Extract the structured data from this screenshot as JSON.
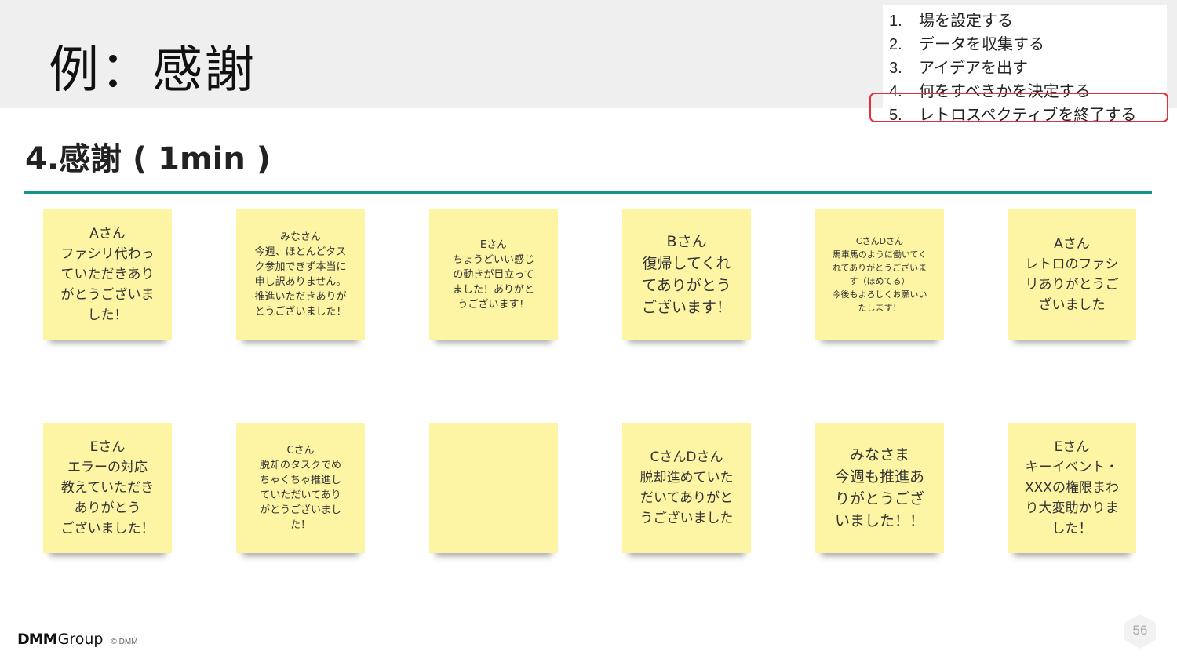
{
  "slide": {
    "title": "例：感謝",
    "board_title": "4.感謝 ( 1min )",
    "page_number": "56"
  },
  "steps": [
    {
      "num": "1.",
      "label": "場を設定する"
    },
    {
      "num": "2.",
      "label": "データを収集する"
    },
    {
      "num": "3.",
      "label": "アイデアを出す"
    },
    {
      "num": "4.",
      "label": "何をすべきかを決定する"
    },
    {
      "num": "5.",
      "label": "レトロスペクティブを終了する"
    }
  ],
  "highlighted_step": "5.",
  "notes": [
    {
      "text": "Aさん\nファシリ代わっ\nていただきあり\nがとうございま\nした！"
    },
    {
      "text": "みなさん\n今週、ほとんどタス\nク参加できず本当に\n申し訳ありません。\n推進いただきありが\nとうございました！"
    },
    {
      "text": "Eさん\nちょうどいい感じ\nの動きが目立って\nました！ありがと\nうございます！"
    },
    {
      "text": "Bさん\n復帰してくれ\nてありがとう\nございます！"
    },
    {
      "text": "CさんDさん\n馬車馬のように働いてく\nれてありがとうございま\nす（ほめてる）\n今後もよろしくお願いい\nたします！"
    },
    {
      "text": "Aさん\nレトロのファシ\nリありがとうご\nざいました"
    },
    {
      "text": "Eさん\nエラーの対応\n教えていただき\nありがとう\nございました！"
    },
    {
      "text": "Cさん\n脱却のタスクでめ\nちゃくちゃ推進し\nていただいてあり\nがとうございまし\nた！"
    },
    {
      "text": ""
    },
    {
      "text": "CさんDさん\n脱却進めていた\nだいてありがと\nうございました"
    },
    {
      "text": "みなさま\n今週も推進あ\nりがとうござ\nいました！！"
    },
    {
      "text": "Eさん\nキーイベント・\nXXXの権限まわ\nり大変助かりま\nした！"
    }
  ],
  "footer": {
    "logo_dmm": "DMM",
    "logo_group": "Group",
    "copyright": "© DMM"
  },
  "colors": {
    "header_band": "#efefef",
    "sticky_note": "#fdf5a4",
    "teal_rule": "#17938e",
    "highlight_border": "#e0303a"
  }
}
